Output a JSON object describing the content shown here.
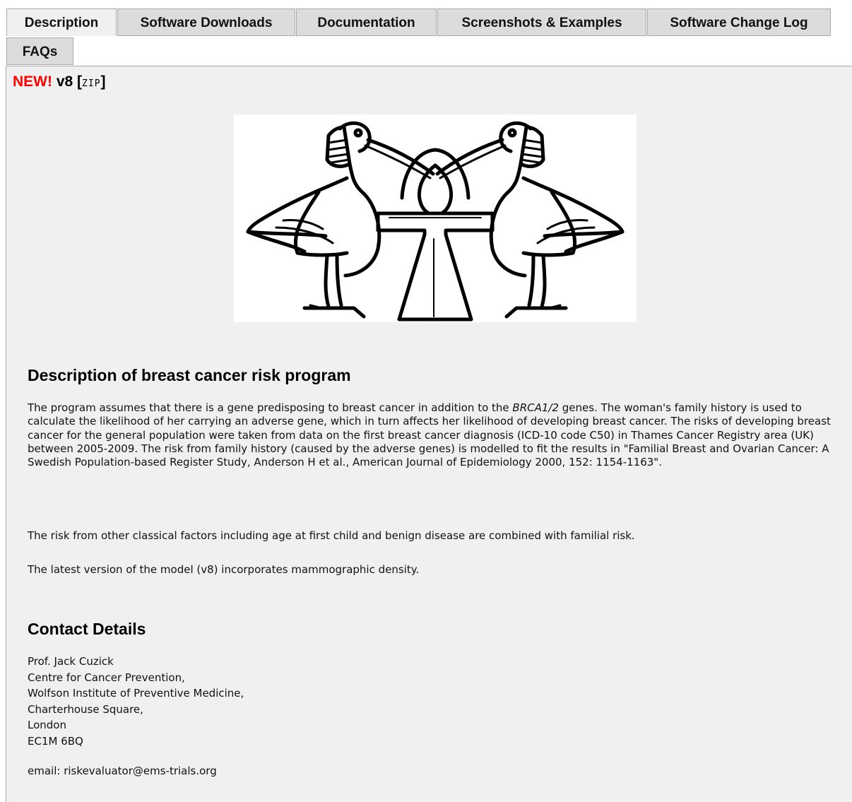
{
  "tabs": [
    {
      "label": "Description",
      "active": true
    },
    {
      "label": "Software Downloads",
      "active": false
    },
    {
      "label": "Documentation",
      "active": false
    },
    {
      "label": "Screenshots & Examples",
      "active": false
    },
    {
      "label": "Software Change Log",
      "active": false
    },
    {
      "label": "FAQs",
      "active": false
    }
  ],
  "release": {
    "new_label": "NEW!",
    "version": "v8",
    "bracket_open": "[",
    "zip_label": "ZIP",
    "bracket_close": "]"
  },
  "logo": {
    "icon": "ibis-ankh-logo"
  },
  "description": {
    "title": "Description of breast cancer risk program",
    "p1_before_italic": "The program assumes that there is a gene predisposing to breast cancer in addition to the ",
    "p1_italic": "BRCA1/2",
    "p1_after_italic": " genes. The woman's family history is used to calculate the likelihood of her carrying an adverse gene, which in turn affects her likelihood of developing breast cancer. The risks of developing breast cancer for the general population were taken from data on the first breast cancer diagnosis (ICD-10 code C50) in Thames Cancer Registry area (UK) between 2005-2009. The risk from family history (caused by the adverse genes) is modelled to fit the results in \"Familial Breast and Ovarian Cancer: A Swedish Population-based Register Study, Anderson H et al., American Journal of Epidemiology 2000, 152: 1154-1163\".",
    "p2": "The risk from other classical factors including age at first child and benign disease are combined with familial risk.",
    "p3": "The latest version of the model (v8) incorporates mammographic density."
  },
  "contact": {
    "title": "Contact Details",
    "lines": [
      "Prof. Jack Cuzick",
      "Centre for Cancer Prevention,",
      "Wolfson Institute of Preventive Medicine,",
      "Charterhouse Square,",
      "London",
      "EC1M 6BQ"
    ],
    "email_label": "email:",
    "email": "riskevaluator@ems-trials.org"
  },
  "colors": {
    "new": "#ff0000",
    "panel_bg": "#f0f0f0",
    "tab_bg": "#dcdcdc"
  }
}
